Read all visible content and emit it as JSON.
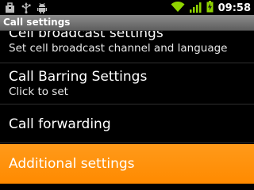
{
  "status_bar": {
    "time": "09:58",
    "icons": [
      "briefcase-icon",
      "usb-icon",
      "android-debug-icon",
      "wifi-icon",
      "signal-icon",
      "battery-charging-icon"
    ]
  },
  "title_bar": {
    "title": "Call settings"
  },
  "list": {
    "items": [
      {
        "title": "Cell broadcast settings",
        "subtitle": "Set cell broadcast channel and language"
      },
      {
        "title": "Call Barring Settings",
        "subtitle": "Click to set"
      },
      {
        "title": "Call forwarding"
      },
      {
        "title": "Additional settings",
        "highlighted": true
      }
    ]
  },
  "colors": {
    "highlight": "#ff8a00",
    "title_bar": "#6e6e6e",
    "background": "#000000",
    "signal_green": "#8fd400"
  }
}
